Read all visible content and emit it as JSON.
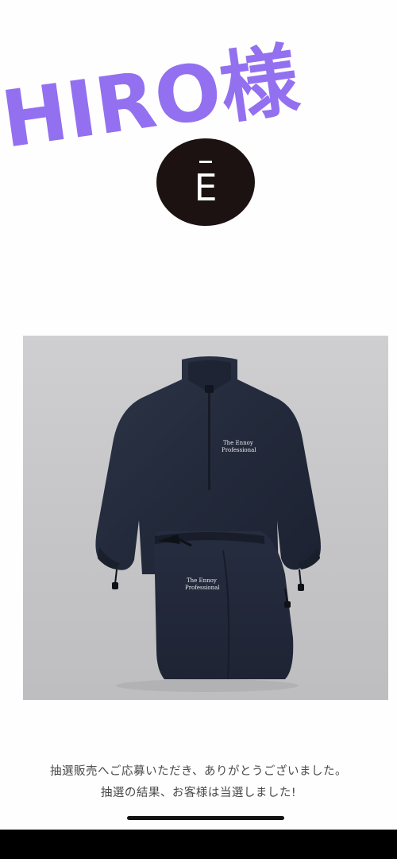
{
  "overlay": {
    "label": "HIRO様",
    "color": "#9370f0"
  },
  "logo": {
    "letter": "Ē",
    "icon": "brand-logo-icon",
    "background": "#1c1212"
  },
  "product": {
    "print_line_1": "The Ennoy",
    "print_line_2": "Professional",
    "icon": "fleece-setup-photo"
  },
  "messages": {
    "line1": "抽選販売へご応募いただき、ありがとうございました。",
    "line2": "抽選の結果、お客様は当選しました!"
  }
}
